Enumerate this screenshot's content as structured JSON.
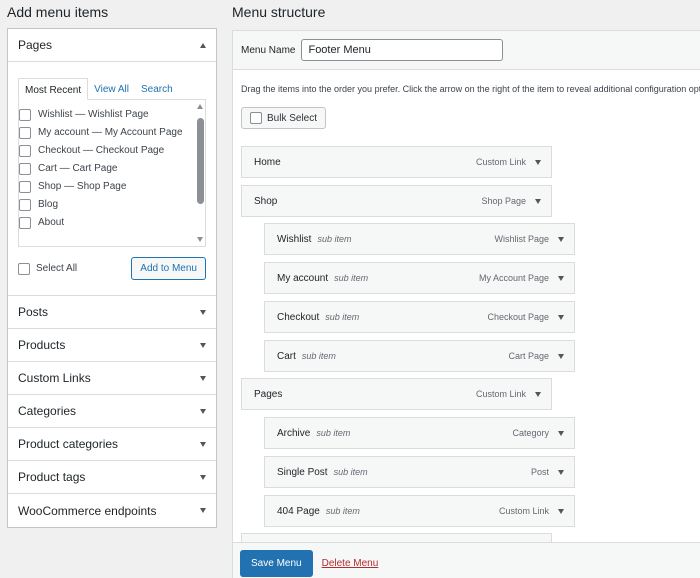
{
  "left": {
    "title": "Add menu items",
    "pages": {
      "header": "Pages",
      "tabs": [
        "Most Recent",
        "View All",
        "Search"
      ],
      "items": [
        "Wishlist — Wishlist Page",
        "My account — My Account Page",
        "Checkout — Checkout Page",
        "Cart — Cart Page",
        "Shop — Shop Page",
        "Blog",
        "About"
      ],
      "select_all": "Select All",
      "add_button": "Add to Menu"
    },
    "sections": [
      "Posts",
      "Products",
      "Custom Links",
      "Categories",
      "Product categories",
      "Product tags",
      "WooCommerce endpoints"
    ]
  },
  "right": {
    "title": "Menu structure",
    "name_label": "Menu Name",
    "name_value": "Footer Menu",
    "instructions": "Drag the items into the order you prefer. Click the arrow on the right of the item to reveal additional configuration options.",
    "bulk_select": "Bulk Select",
    "sub_label": "sub item",
    "items": [
      {
        "title": "Home",
        "type": "Custom Link"
      },
      {
        "title": "Shop",
        "type": "Shop Page"
      },
      {
        "title": "Wishlist",
        "type": "Wishlist Page"
      },
      {
        "title": "My account",
        "type": "My Account Page"
      },
      {
        "title": "Checkout",
        "type": "Checkout Page"
      },
      {
        "title": "Cart",
        "type": "Cart Page"
      },
      {
        "title": "Pages",
        "type": "Custom Link"
      },
      {
        "title": "Archive",
        "type": "Category"
      },
      {
        "title": "Single Post",
        "type": "Post"
      },
      {
        "title": "404 Page",
        "type": "Custom Link"
      }
    ],
    "save_button": "Save Menu",
    "delete_link": "Delete Menu"
  }
}
